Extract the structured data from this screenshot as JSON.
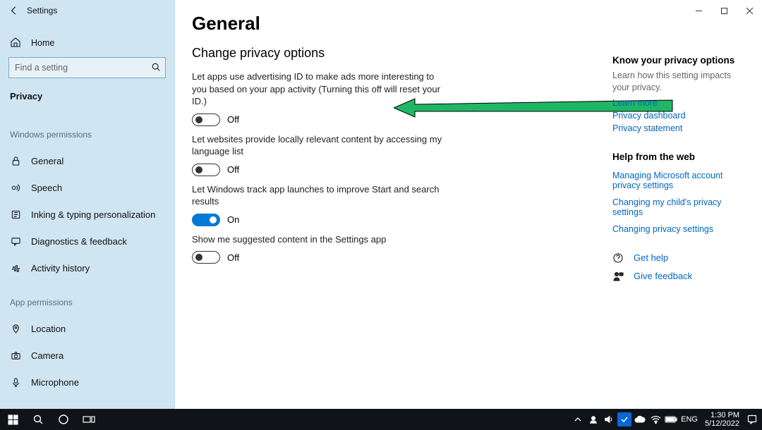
{
  "window": {
    "title": "Settings"
  },
  "sidebar": {
    "home": "Home",
    "search_placeholder": "Find a setting",
    "category": "Privacy",
    "group_win_perm": "Windows permissions",
    "group_app_perm": "App permissions",
    "items_win": {
      "general": "General",
      "speech": "Speech",
      "inking": "Inking & typing personalization",
      "diagnostics": "Diagnostics & feedback",
      "activity": "Activity history"
    },
    "items_app": {
      "location": "Location",
      "camera": "Camera",
      "microphone": "Microphone"
    }
  },
  "main": {
    "title": "General",
    "subtitle": "Change privacy options",
    "opts": [
      {
        "desc": "Let apps use advertising ID to make ads more interesting to you based on your app activity (Turning this off will reset your ID.)",
        "on": false,
        "label": "Off"
      },
      {
        "desc": "Let websites provide locally relevant content by accessing my language list",
        "on": false,
        "label": "Off"
      },
      {
        "desc": "Let Windows track app launches to improve Start and search results",
        "on": true,
        "label": "On"
      },
      {
        "desc": "Show me suggested content in the Settings app",
        "on": false,
        "label": "Off"
      }
    ]
  },
  "info": {
    "know_title": "Know your privacy options",
    "know_text": "Learn how this setting impacts your privacy.",
    "links1": {
      "learn": "Learn more",
      "dash": "Privacy dashboard",
      "stmt": "Privacy statement"
    },
    "help_title": "Help from the web",
    "links2": {
      "a": "Managing Microsoft account privacy settings",
      "b": "Changing my child's privacy settings",
      "c": "Changing privacy settings"
    },
    "gethelp": "Get help",
    "feedback": "Give feedback"
  },
  "taskbar": {
    "lang": "ENG",
    "time": "1:30 PM",
    "date": "5/12/2022"
  }
}
